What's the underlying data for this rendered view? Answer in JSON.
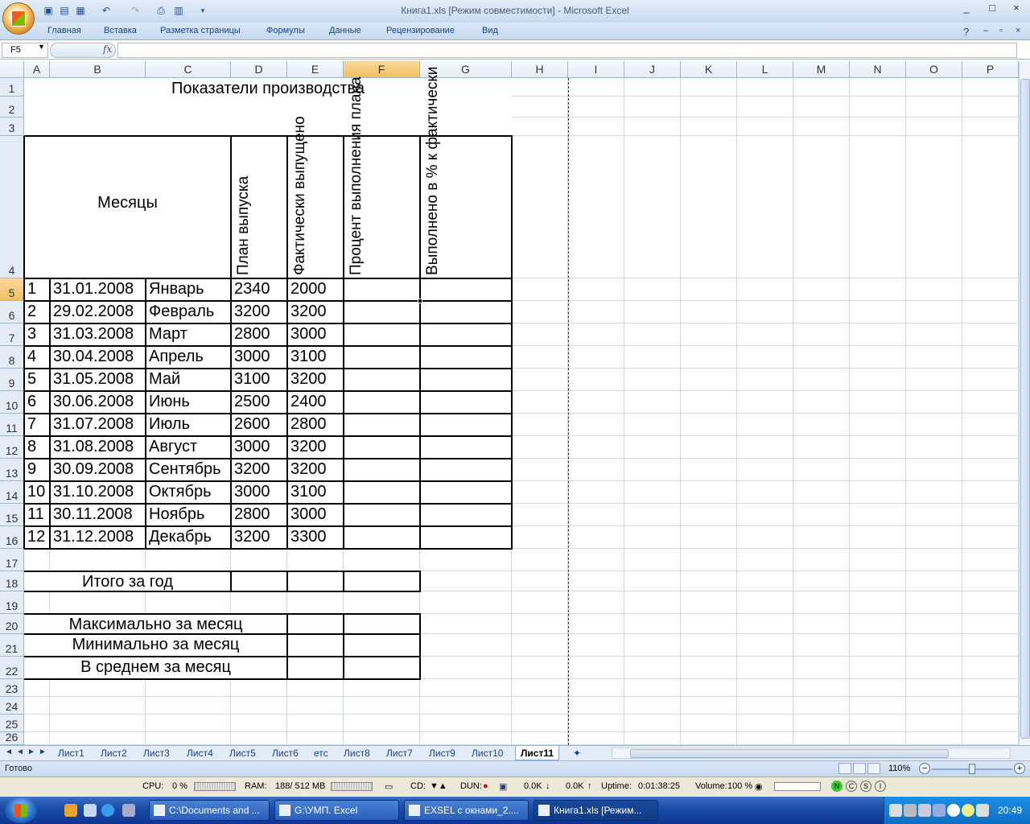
{
  "window": {
    "title": "Книга1.xls  [Режим совместимости] - Microsoft Excel",
    "controls": [
      "_",
      "□",
      "×"
    ]
  },
  "quick_access": {
    "icons": [
      "save-icon",
      "open-icon",
      "print-icon",
      "undo-icon",
      "redo-icon",
      "print-preview-icon",
      "customize-icon"
    ]
  },
  "ribbon": {
    "tabs": [
      "Главная",
      "Вставка",
      "Разметка страницы",
      "Формулы",
      "Данные",
      "Рецензирование",
      "Вид"
    ]
  },
  "formula_bar": {
    "name_box": "F5",
    "fx": "fx",
    "formula": ""
  },
  "sheet": {
    "columns": [
      "A",
      "B",
      "C",
      "D",
      "E",
      "F",
      "G",
      "H",
      "I",
      "J",
      "K",
      "L",
      "M",
      "N",
      "O",
      "P"
    ],
    "selected_column": "F",
    "rows": [
      "1",
      "2",
      "3",
      "4",
      "5",
      "6",
      "7",
      "8",
      "9",
      "10",
      "11",
      "12",
      "13",
      "14",
      "15",
      "16",
      "17",
      "18",
      "19",
      "20",
      "21",
      "22",
      "23",
      "24",
      "25",
      "26"
    ],
    "selected_row": "5",
    "title": "Показатели производства",
    "headers": {
      "months": "Месяцы",
      "plan": "План выпуска",
      "actual": "Фактически выпущено",
      "percent_plan": "Процент выполнения плана",
      "percent_year": "Выполнено в % к фактически выпушенному за год"
    },
    "data": [
      {
        "n": "1",
        "date": "31.01.2008",
        "month": "Январь",
        "plan": "2340",
        "actual": "2000"
      },
      {
        "n": "2",
        "date": "29.02.2008",
        "month": "Февраль",
        "plan": "3200",
        "actual": "3200"
      },
      {
        "n": "3",
        "date": "31.03.2008",
        "month": "Март",
        "plan": "2800",
        "actual": "3000"
      },
      {
        "n": "4",
        "date": "30.04.2008",
        "month": "Апрель",
        "plan": "3000",
        "actual": "3100"
      },
      {
        "n": "5",
        "date": "31.05.2008",
        "month": "Май",
        "plan": "3100",
        "actual": "3200"
      },
      {
        "n": "6",
        "date": "30.06.2008",
        "month": "Июнь",
        "plan": "2500",
        "actual": "2400"
      },
      {
        "n": "7",
        "date": "31.07.2008",
        "month": "Июль",
        "plan": "2600",
        "actual": "2800"
      },
      {
        "n": "8",
        "date": "31.08.2008",
        "month": "Август",
        "plan": "3000",
        "actual": "3200"
      },
      {
        "n": "9",
        "date": "30.09.2008",
        "month": "Сентябрь",
        "plan": "3200",
        "actual": "3200"
      },
      {
        "n": "10",
        "date": "31.10.2008",
        "month": "Октябрь",
        "plan": "3000",
        "actual": "3100"
      },
      {
        "n": "11",
        "date": "30.11.2008",
        "month": "Ноябрь",
        "plan": "2800",
        "actual": "3000"
      },
      {
        "n": "12",
        "date": "31.12.2008",
        "month": "Декабрь",
        "plan": "3200",
        "actual": "3300"
      }
    ],
    "total_label": "Итого за год",
    "max_label": "Максимально за месяц",
    "min_label": "Минимально за месяц",
    "avg_label": "В среднем за месяц"
  },
  "sheet_tabs": {
    "tabs": [
      "Лист1",
      "Лист2",
      "Лист3",
      "Лист4",
      "Лист5",
      "Лист6",
      "етс",
      "Лист8",
      "Лист7",
      "Лист9",
      "Лист10",
      "Лист11"
    ],
    "active": "Лист11"
  },
  "status_bar": {
    "status": "Готово",
    "zoom": "110%"
  },
  "system_monitor": {
    "cpu_label": "CPU:",
    "cpu_value": "0 %",
    "ram_label": "RAM:",
    "ram_value": "188/ 512 MB",
    "cd_label": "CD:",
    "dun_label": "DUN:",
    "down": "0.0K",
    "up": "0.0K",
    "uptime_label": "Uptime:",
    "uptime_value": "0:01:38:25",
    "volume_label": "Volume:",
    "volume_value": "100 %",
    "indicators": [
      "N",
      "C",
      "S",
      "I"
    ]
  },
  "taskbar": {
    "items": [
      "C:\\Documents and ...",
      "G:\\УМП. Excel",
      "EXSEL с окнами_2....",
      "Книга1.xls  [Режим..."
    ],
    "active_index": 3,
    "clock": "20:49"
  }
}
